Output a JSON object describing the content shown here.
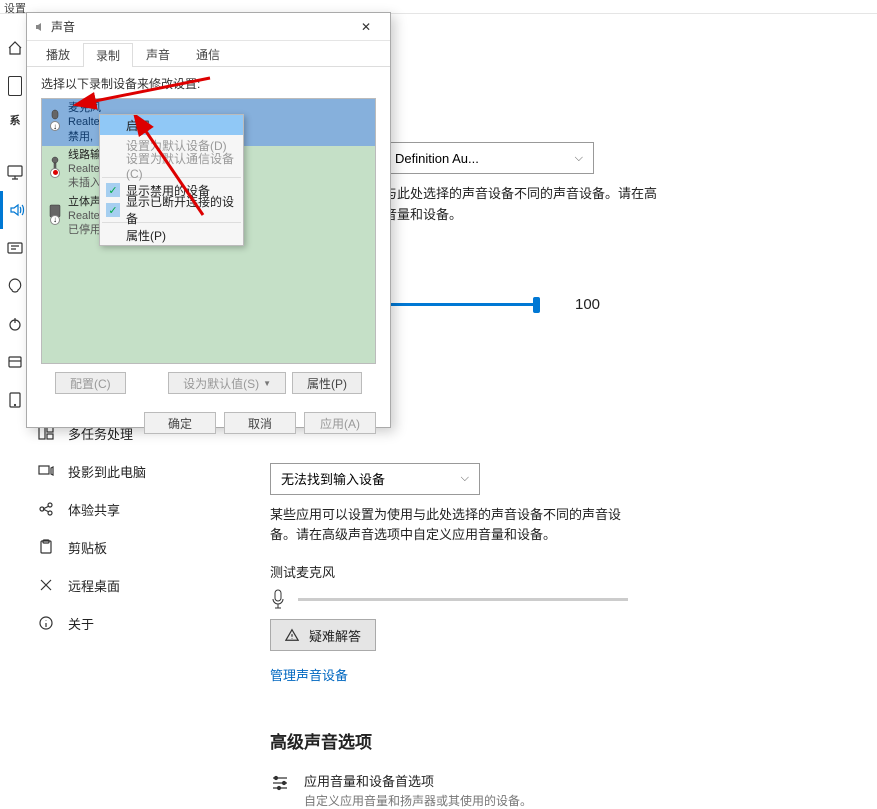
{
  "top": {
    "title": "设置"
  },
  "rail": {
    "sys": "系"
  },
  "nav": {
    "items": [
      {
        "label": "多任务处理"
      },
      {
        "label": "投影到此电脑"
      },
      {
        "label": "体验共享"
      },
      {
        "label": "剪贴板"
      },
      {
        "label": "远程桌面"
      },
      {
        "label": "关于"
      }
    ]
  },
  "content": {
    "output_dropdown": "Definition Au...",
    "desc1": "与此处选择的声音设备不同的声音设备。请在高",
    "desc2": "音量和设备。",
    "volume": "100",
    "input_dropdown": "无法找到输入设备",
    "input_desc1": "某些应用可以设置为使用与此处选择的声音设备不同的声音设备。请在高级声音选项中自定义应用音量和设备。",
    "mic_label": "测试麦克风",
    "trouble_btn": "疑难解答",
    "manage_link": "管理声音设备",
    "adv_title": "高级声音选项",
    "adv_main": "应用音量和设备首选项",
    "adv_sub": "自定义应用音量和扬声器或其使用的设备。"
  },
  "dialog": {
    "title": "声音",
    "tabs": [
      "播放",
      "录制",
      "声音",
      "通信"
    ],
    "active_tab": 1,
    "hint": "选择以下录制设备来修改设置:",
    "devices": [
      {
        "name": "麦克风",
        "driver": "Realtek High Definition Audio",
        "status": "禁用, "
      },
      {
        "name": "线路输入",
        "driver": "Realtek",
        "status": "未插入"
      },
      {
        "name": "立体声混",
        "driver": "Realtek",
        "status": "已停用"
      }
    ],
    "context": {
      "items": [
        {
          "label": "启用",
          "hl": true
        },
        {
          "label": "设置为默认设备(D)",
          "disabled": true
        },
        {
          "label": "设置为默认通信设备(C)",
          "disabled": true
        },
        {
          "label": "显示禁用的设备",
          "check": true
        },
        {
          "label": "显示已断开连接的设备",
          "check": true
        },
        {
          "label": "属性(P)"
        }
      ]
    },
    "footer": {
      "config": "配置(C)",
      "default": "设为默认值(S)",
      "props": "属性(P)"
    },
    "bottom": {
      "ok": "确定",
      "cancel": "取消",
      "apply": "应用(A)"
    }
  }
}
